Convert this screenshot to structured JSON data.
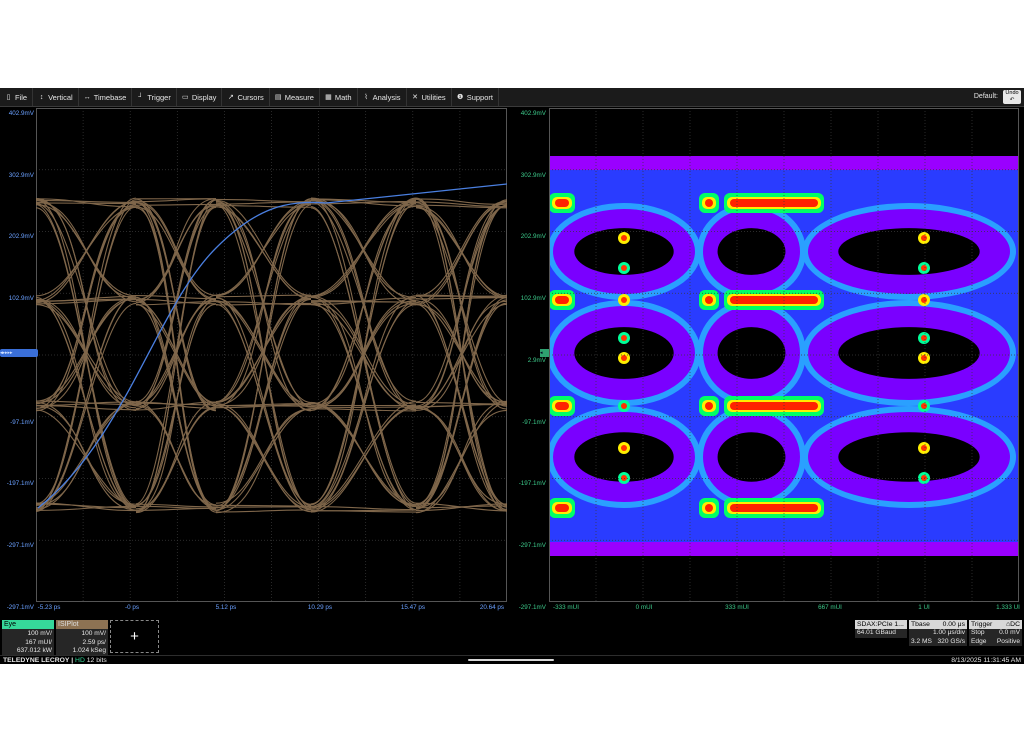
{
  "menu": {
    "items": [
      {
        "icon": "file-icon",
        "glyph": "▯",
        "label": "File"
      },
      {
        "icon": "vertical-icon",
        "glyph": "↕",
        "label": "Vertical"
      },
      {
        "icon": "timebase-icon",
        "glyph": "↔",
        "label": "Timebase"
      },
      {
        "icon": "trigger-icon",
        "glyph": "┘",
        "label": "Trigger"
      },
      {
        "icon": "display-icon",
        "glyph": "▭",
        "label": "Display"
      },
      {
        "icon": "cursors-icon",
        "glyph": "↗",
        "label": "Cursors"
      },
      {
        "icon": "measure-icon",
        "glyph": "▤",
        "label": "Measure"
      },
      {
        "icon": "math-icon",
        "glyph": "▦",
        "label": "Math"
      },
      {
        "icon": "analysis-icon",
        "glyph": "⌇",
        "label": "Analysis"
      },
      {
        "icon": "utilities-icon",
        "glyph": "✕",
        "label": "Utilities"
      },
      {
        "icon": "support-icon",
        "glyph": "❶",
        "label": "Support"
      }
    ],
    "default_label": "Default:",
    "undo_label": "Undo"
  },
  "left_grid": {
    "y_labels": [
      "402.9mV",
      "302.9mV",
      "202.9mV",
      "102.9mV",
      "",
      "-97.1mV",
      "-197.1mV",
      "-297.1mV",
      "-297.1mV"
    ],
    "x_labels": [
      "-5.23 ps",
      "-0 ps",
      "5.12 ps",
      "10.29 ps",
      "15.47 ps",
      "20.64 ps"
    ],
    "trace_color": "#8d7253",
    "overlay_color": "#4a7fe0"
  },
  "right_grid": {
    "y_labels": [
      "402.9mV",
      "302.9mV",
      "202.9mV",
      "102.9mV",
      "2.9mV",
      "-97.1mV",
      "-197.1mV",
      "-297.1mV",
      "-297.1mV"
    ],
    "x_labels": [
      "-333 mUI",
      "0 mUI",
      "333 mUI",
      "667 mUI",
      "1 UI",
      "1.333 UI"
    ]
  },
  "eye": {
    "name": "Eye",
    "rows": [
      "100 mV/",
      "167 mUI/",
      "637.012 kW"
    ]
  },
  "isi": {
    "name": "ISIPlot",
    "rows": [
      "100 mV/",
      "2.59 ps/",
      "1.024 kSeg"
    ]
  },
  "sdax": {
    "name": "SDAX:PCIe 1...",
    "rate": "64.01 GBaud"
  },
  "tbase": {
    "name": "Tbase",
    "delay": "0.00 μs",
    "per_div": "1.00 μs/div",
    "samples": "3.2 MS",
    "rate": "320 GS/s"
  },
  "trigger": {
    "name": "Trigger",
    "coupling": "DC",
    "mode": "Stop",
    "level": "0.0 mV",
    "type": "Edge",
    "slope": "Positive"
  },
  "status": {
    "brand": "TELEDYNE LECROY",
    "hd": "HD",
    "bits": "12 bits",
    "datetime": "8/13/2025 11:31:45 AM"
  }
}
